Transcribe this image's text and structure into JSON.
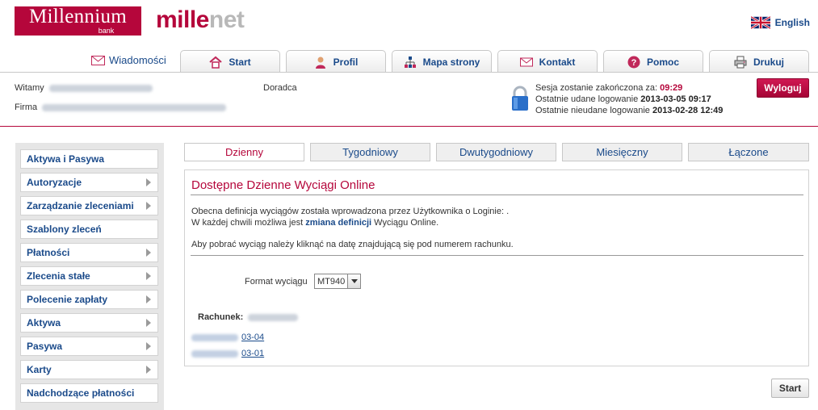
{
  "brand": {
    "logo_main": "Millennium",
    "logo_sub": "bank",
    "app_a": "mille",
    "app_b": "net"
  },
  "language": {
    "label": "English"
  },
  "nav": {
    "messages": "Wiadomości",
    "tabs": [
      {
        "label": "Start",
        "icon": "home-icon"
      },
      {
        "label": "Profil",
        "icon": "person-icon"
      },
      {
        "label": "Mapa strony",
        "icon": "sitemap-icon"
      },
      {
        "label": "Kontakt",
        "icon": "envelope-icon"
      },
      {
        "label": "Pomoc",
        "icon": "help-icon"
      },
      {
        "label": "Drukuj",
        "icon": "printer-icon"
      }
    ]
  },
  "user": {
    "welcome_label": "Witamy",
    "company_label": "Firma",
    "advisor_label": "Doradca"
  },
  "session": {
    "expires_label": "Sesja zostanie zakończona za:",
    "expires_value": "09:29",
    "last_ok_label": "Ostatnie udane logowanie",
    "last_ok_value": "2013-03-05 09:17",
    "last_fail_label": "Ostatnie nieudane logowanie",
    "last_fail_value": "2013-02-28 12:49",
    "logout": "Wyloguj"
  },
  "sidebar": {
    "items": [
      {
        "label": "Aktywa i Pasywa",
        "arrow": false
      },
      {
        "label": "Autoryzacje",
        "arrow": true
      },
      {
        "label": "Zarządzanie zleceniami",
        "arrow": true
      },
      {
        "label": "Szablony zleceń",
        "arrow": false
      },
      {
        "label": "Płatności",
        "arrow": true
      },
      {
        "label": "Zlecenia stałe",
        "arrow": true
      },
      {
        "label": "Polecenie zapłaty",
        "arrow": true
      },
      {
        "label": "Aktywa",
        "arrow": true
      },
      {
        "label": "Pasywa",
        "arrow": true
      },
      {
        "label": "Karty",
        "arrow": true
      },
      {
        "label": "Nadchodzące płatności",
        "arrow": false
      }
    ]
  },
  "period_tabs": [
    "Dzienny",
    "Tygodniowy",
    "Dwutygodniowy",
    "Miesięczny",
    "Łączone"
  ],
  "panel": {
    "title": "Dostępne Dzienne Wyciągi Online",
    "line1": "Obecna definicja wyciągów została wprowadzona przez Użytkownika o Loginie: .",
    "line2_pre": "W każdej chwili możliwa jest ",
    "line2_link": "zmiana definicji",
    "line2_post": " Wyciągu Online.",
    "line3": "Aby pobrać wyciąg należy kliknąć na datę znajdującą się pod numerem rachunku.",
    "format_label": "Format wyciągu",
    "format_value": "MT940",
    "account_label": "Rachunek:",
    "dates": [
      "03-04",
      "03-01"
    ]
  },
  "start_button": "Start",
  "colors": {
    "brand": "#b5063b",
    "link": "#1a4a8a"
  }
}
